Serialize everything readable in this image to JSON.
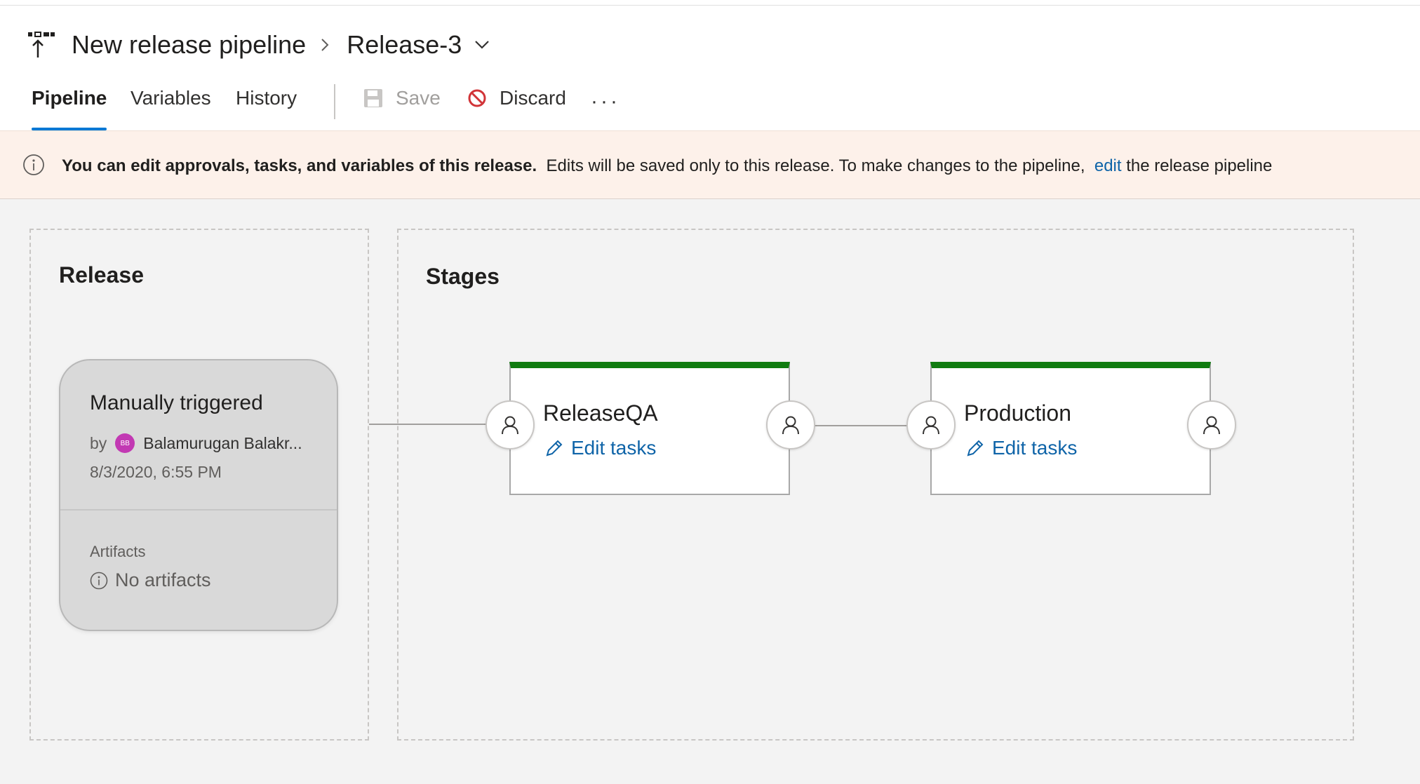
{
  "header": {
    "pipeline_title": "New release pipeline",
    "release_name": "Release-3"
  },
  "tabs": [
    {
      "label": "Pipeline",
      "active": true
    },
    {
      "label": "Variables",
      "active": false
    },
    {
      "label": "History",
      "active": false
    }
  ],
  "toolbar": {
    "save_label": "Save",
    "discard_label": "Discard",
    "more_label": "···"
  },
  "banner": {
    "bold_text": "You can edit approvals, tasks, and variables of this release.",
    "text": "Edits will be saved only to this release. To make changes to the pipeline,",
    "link_text": "edit",
    "tail_text": "the release pipeline"
  },
  "release_panel": {
    "title": "Release",
    "card": {
      "title": "Manually triggered",
      "by_label": "by",
      "avatar_initials": "BB",
      "user": "Balamurugan Balakr...",
      "date": "8/3/2020, 6:55 PM",
      "artifacts_label": "Artifacts",
      "artifacts_value": "No artifacts"
    }
  },
  "stages_panel": {
    "title": "Stages",
    "stages": [
      {
        "name": "ReleaseQA",
        "edit_label": "Edit tasks",
        "status_color": "#107c10"
      },
      {
        "name": "Production",
        "edit_label": "Edit tasks",
        "status_color": "#107c10"
      }
    ]
  },
  "colors": {
    "accent": "#0078d4",
    "link": "#0f64a8",
    "success": "#107c10",
    "discard_red": "#d13438",
    "avatar": "#c239b3"
  }
}
